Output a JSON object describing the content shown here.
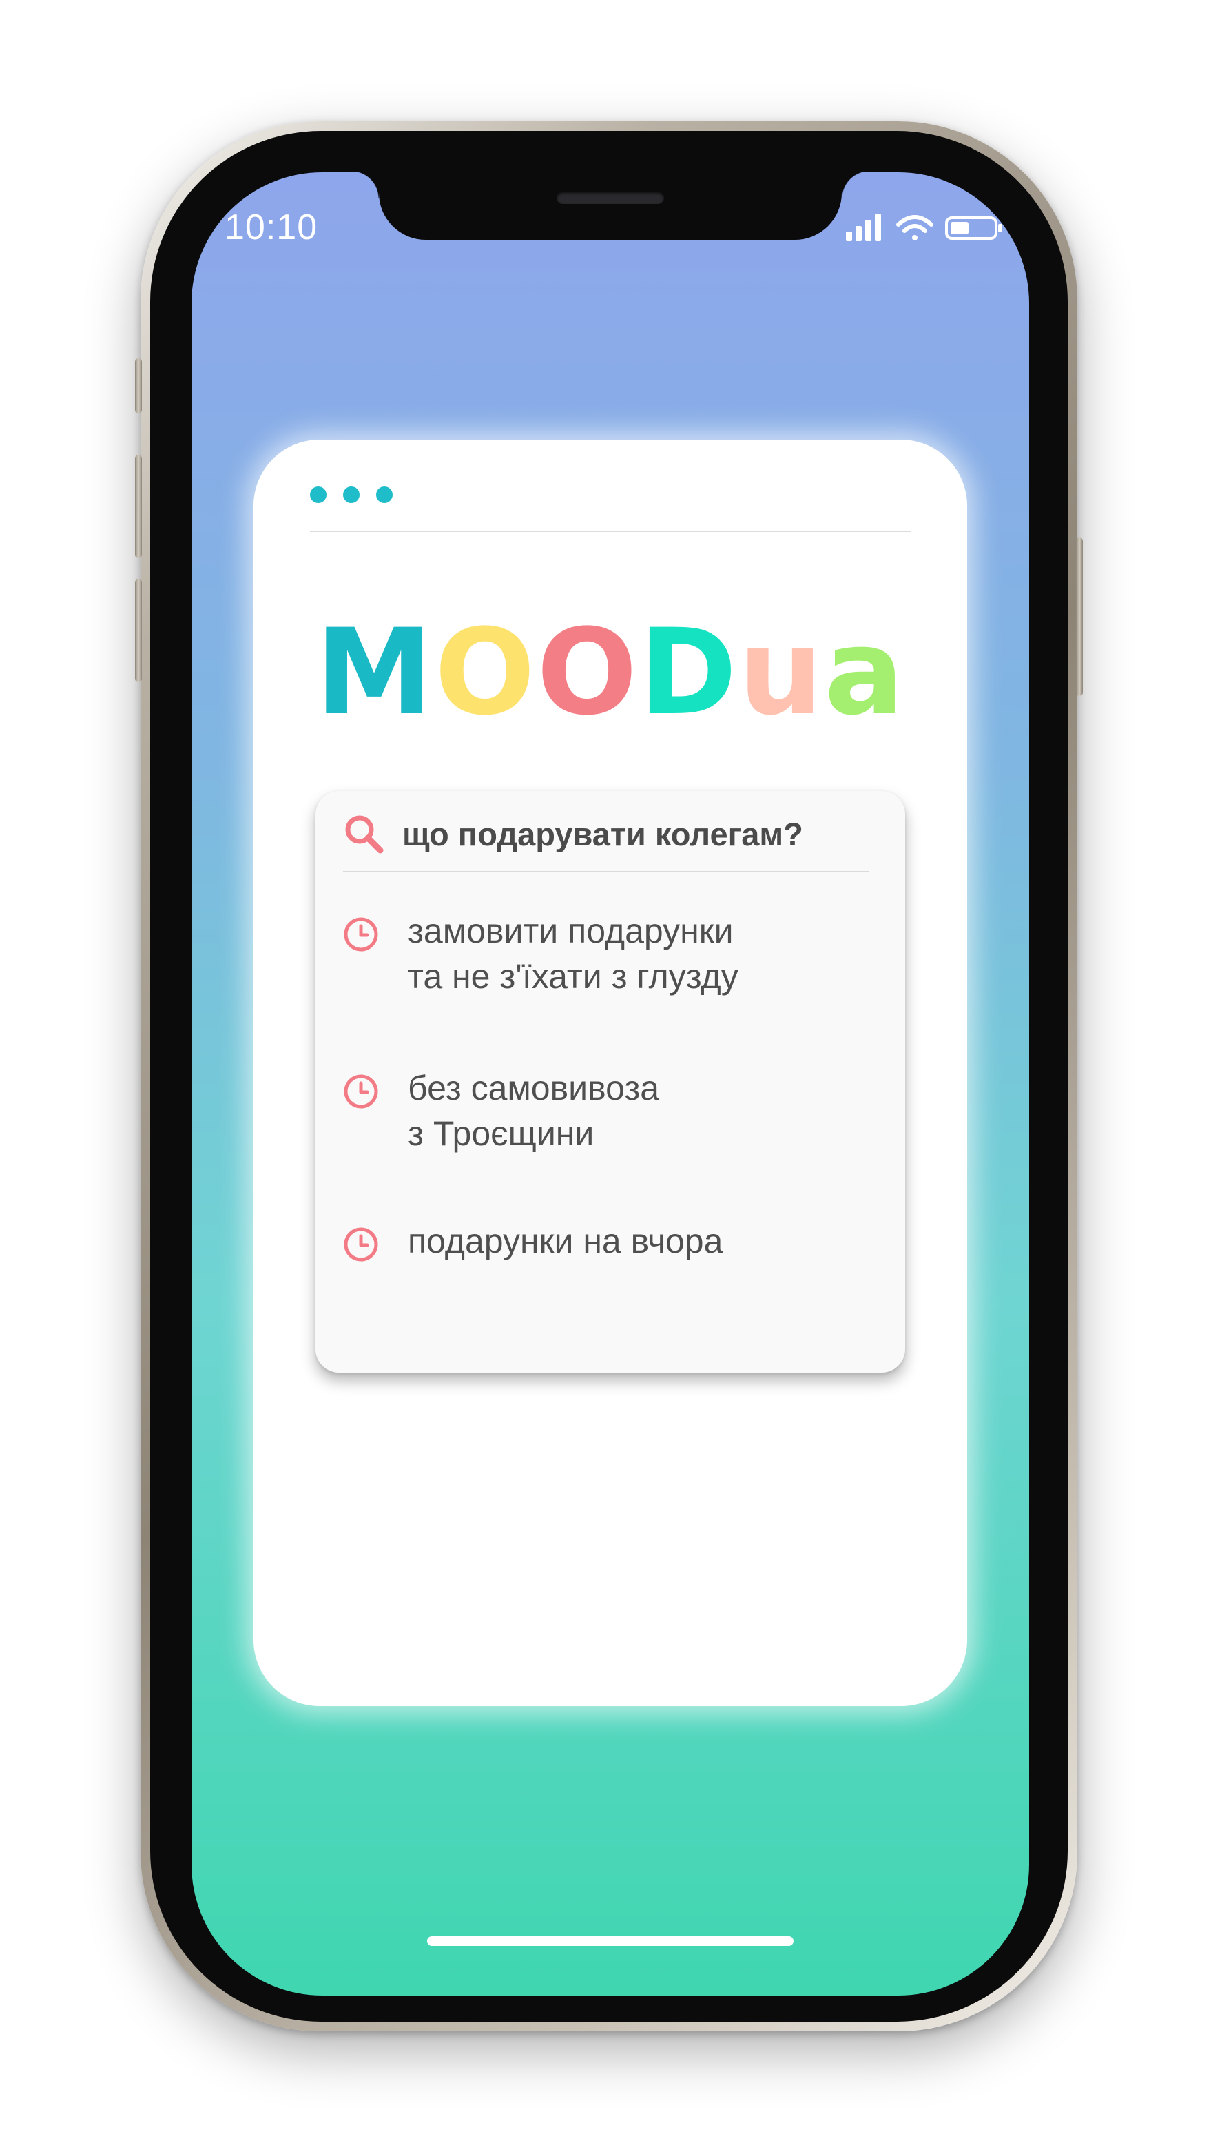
{
  "status_bar": {
    "time": "10:10",
    "icons": [
      "cellular-signal-icon",
      "wifi-icon",
      "battery-icon"
    ]
  },
  "window": {
    "dots": [
      "window-dot",
      "window-dot",
      "window-dot"
    ]
  },
  "logo": {
    "letters": [
      {
        "char": "M",
        "color": "#1ab9c6"
      },
      {
        "char": "O",
        "color": "#fde26e"
      },
      {
        "char": "O",
        "color": "#f47e86"
      },
      {
        "char": "D",
        "color": "#14e2c1"
      },
      {
        "char": "u",
        "color": "#ffc1b0"
      },
      {
        "char": "a",
        "color": "#a4ef6f"
      }
    ]
  },
  "search": {
    "query": "що подарувати колегам?",
    "icon": "search-icon",
    "accent_color": "#f27b85",
    "suggestions": [
      {
        "icon": "clock-icon",
        "lines": [
          "замовити подарунки",
          "та не з'їхати з глузду"
        ]
      },
      {
        "icon": "clock-icon",
        "lines": [
          "без самовивоза",
          "з Троєщини"
        ]
      },
      {
        "icon": "clock-icon",
        "lines": [
          "подарунки на вчора"
        ]
      }
    ]
  },
  "colors": {
    "screen_gradient_top": "#8ea6eb",
    "screen_gradient_bottom": "#3fd6b0",
    "window_dot": "#1fbcc9",
    "text": "#4f4f4f"
  }
}
